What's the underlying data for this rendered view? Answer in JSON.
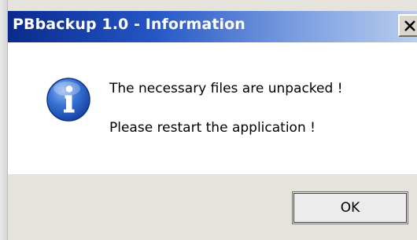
{
  "window": {
    "title": "PBbackup 1.0 - Information",
    "close_symbol": "✕"
  },
  "message": {
    "icon": "info-icon",
    "line1": "The necessary files are unpacked !",
    "line2": "Please restart the application !"
  },
  "buttons": {
    "ok_label": "OK"
  },
  "colors": {
    "titlebar_start": "#0a2a8c",
    "titlebar_end": "#b9cdee",
    "dialog_background": "#e6e3dc",
    "content_background": "#ffffff",
    "info_icon": "#2b63c8"
  }
}
